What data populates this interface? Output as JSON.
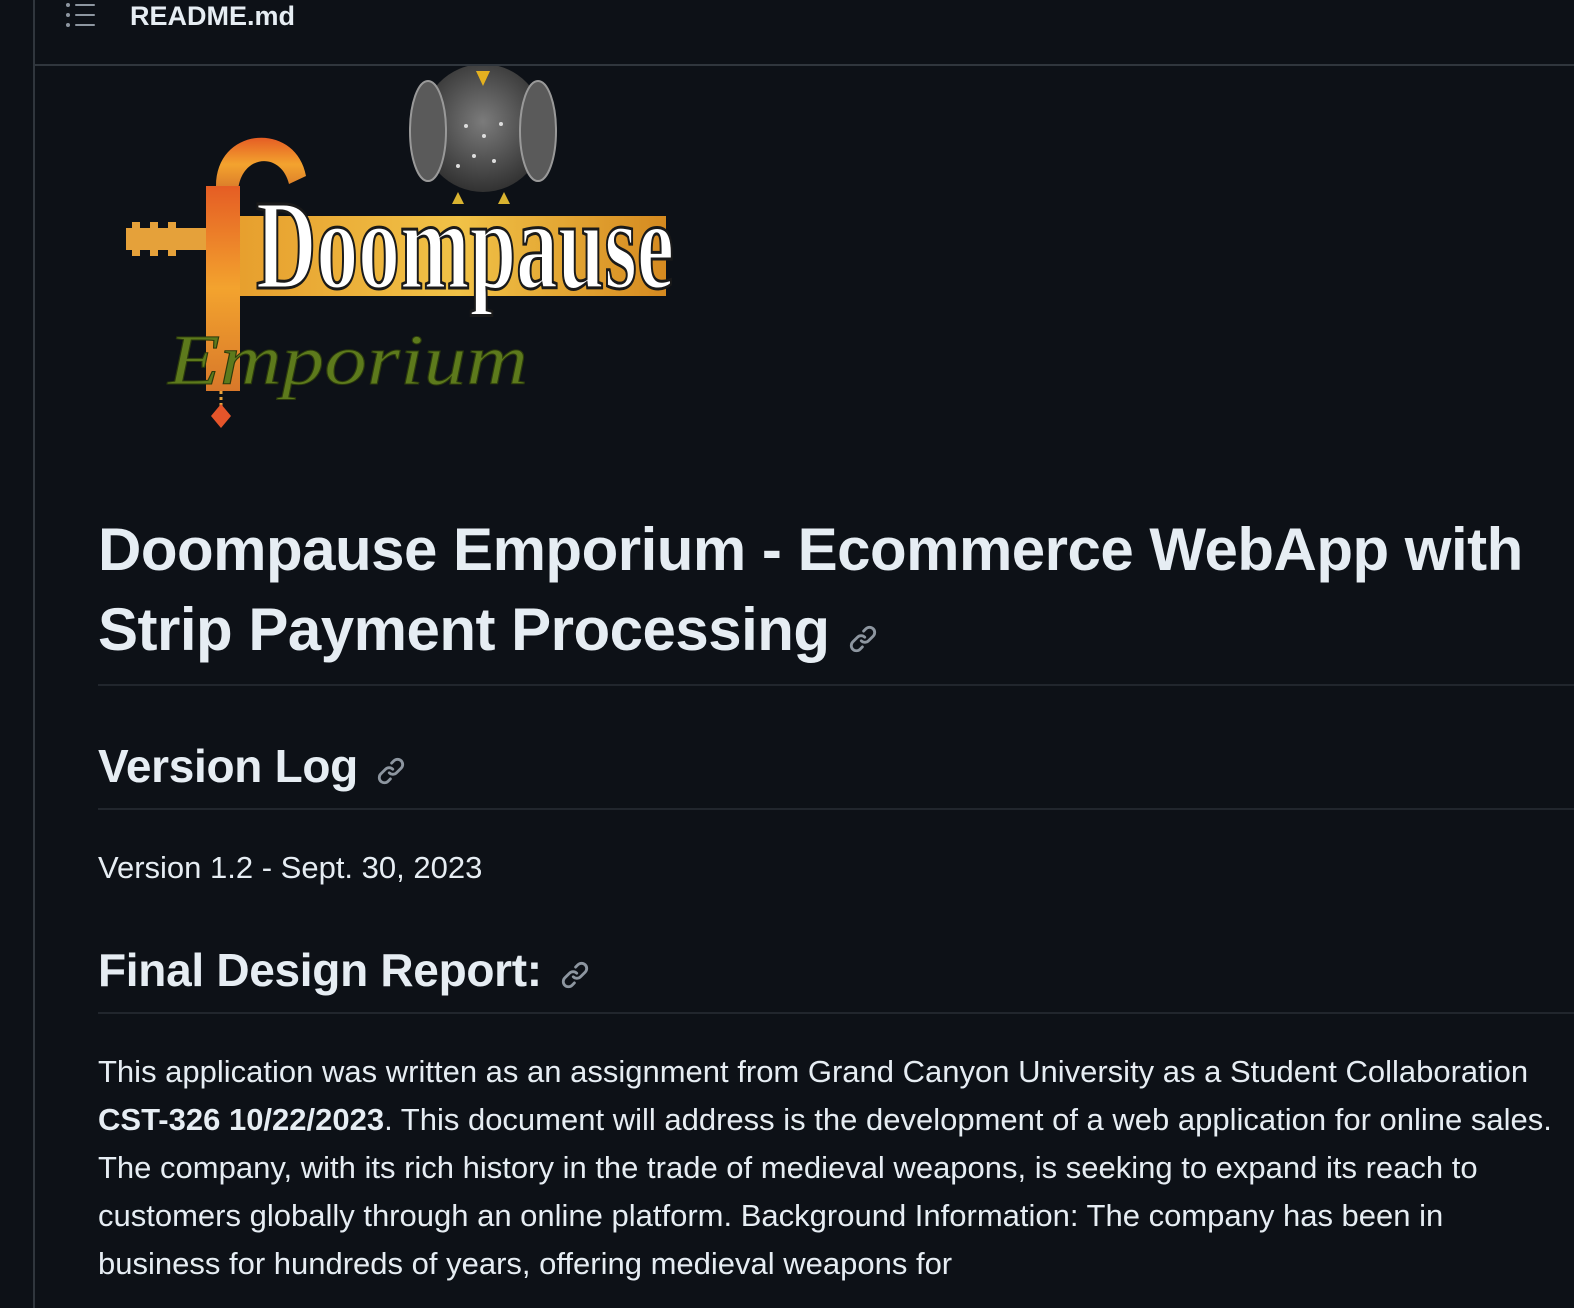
{
  "header": {
    "toc_icon": "list-unordered-icon",
    "file_name": "README.md"
  },
  "logo": {
    "word1": "Doompause",
    "word2": "Emporium"
  },
  "readme": {
    "title": "Doompause Emporium - Ecommerce WebApp with Strip Payment Processing",
    "title_line1": "Doompause Emporium - Ecommerce WebApp with",
    "title_line2": "Strip Payment Processing",
    "version_log_heading": "Version Log",
    "version_text": "Version 1.2 - Sept. 30, 2023",
    "final_report_heading": "Final Design Report:",
    "intro_before_bold": "This application was written as an assignment from Grand Canyon University as a Student Collaboration ",
    "intro_bold": "CST-326 10/22/2023",
    "intro_after_bold": ". This document will address is the development of a web application for online sales. The company, with its rich history in the trade of medieval weapons, is seeking to expand its reach to customers globally through an online platform. Background Information: The company has been in business for hundreds of years, offering medieval weapons for"
  },
  "icons": {
    "anchor": "link-icon"
  },
  "colors": {
    "background": "#0d1117",
    "text": "#e6edf3",
    "border": "#30363d",
    "muted_icon": "#8d96a0"
  }
}
